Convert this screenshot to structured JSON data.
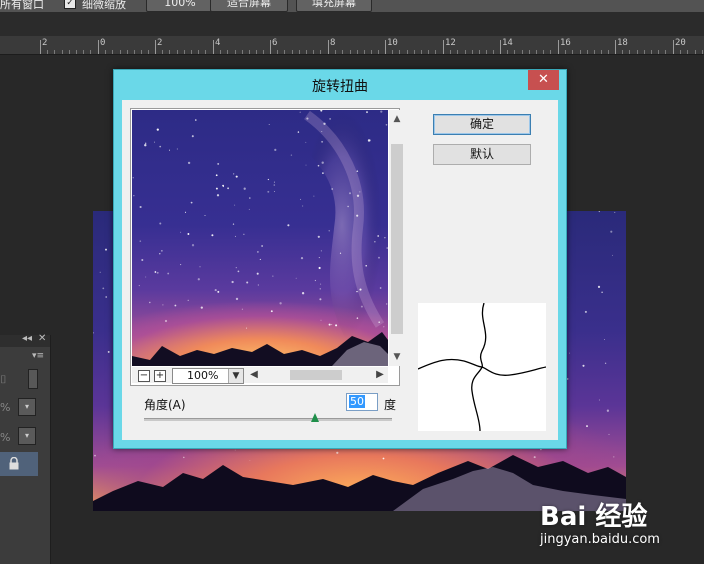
{
  "options_bar": {
    "all_windows_label": "所有窗口",
    "scrubby_zoom_label": "细微缩放",
    "zoom_100_label": "100%",
    "fit_screen_label": "适合屏幕",
    "fill_screen_label": "填充屏幕"
  },
  "ruler": {
    "labels": [
      "2",
      "0",
      "2",
      "4",
      "6",
      "8",
      "10",
      "12",
      "14",
      "16",
      "18",
      "20"
    ]
  },
  "left_panel": {
    "percent_1": "%",
    "percent_2": "%"
  },
  "dialog": {
    "title": "旋转扭曲",
    "close_glyph": "✕",
    "ok_label": "确定",
    "default_label": "默认",
    "zoom_value": "100%",
    "angle_label": "角度(A)",
    "angle_value": "50",
    "angle_unit": "度",
    "angle_fraction": 0.69
  },
  "watermark": {
    "logo": "Bai 经验",
    "url": "jingyan.baidu.com"
  },
  "icons": [
    "checkbox-icon",
    "close-icon",
    "zoom-out-icon",
    "zoom-in-icon",
    "scroll-up-icon",
    "scroll-down-icon",
    "scroll-left-icon",
    "scroll-right-icon",
    "dropdown-icon",
    "lock-icon",
    "paw-icon"
  ]
}
